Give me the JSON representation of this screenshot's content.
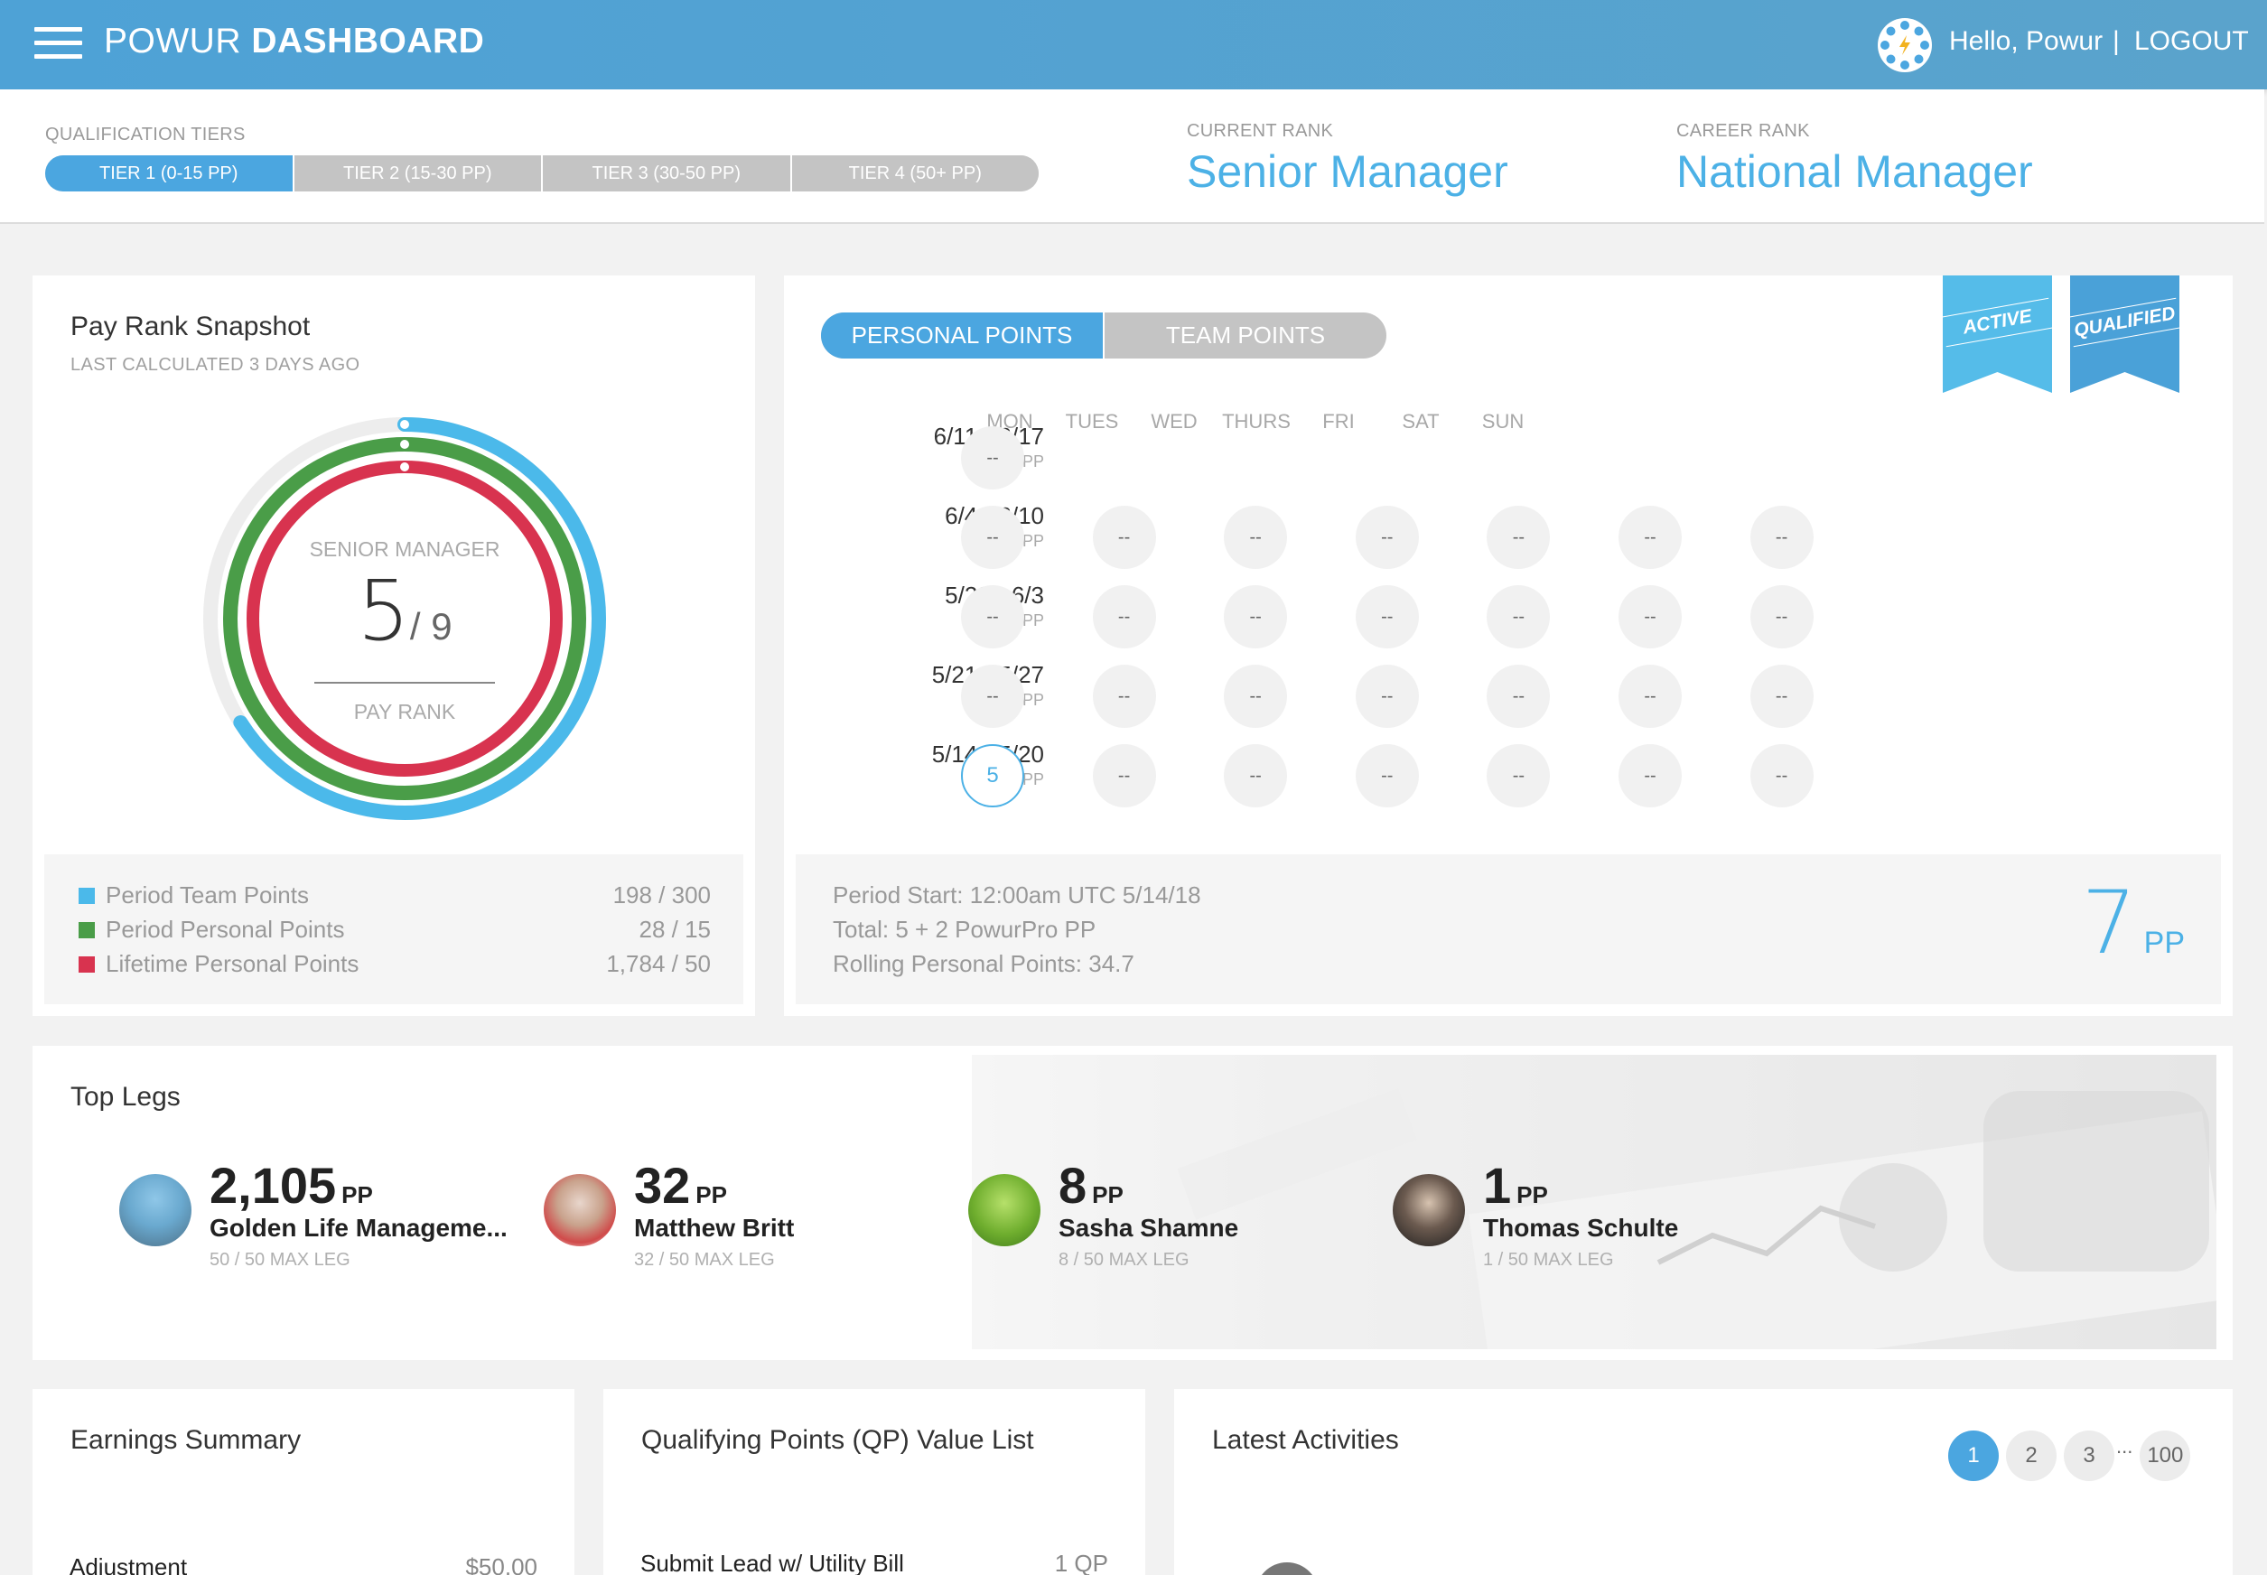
{
  "header": {
    "brand_light": "POWUR ",
    "brand_bold": "DASHBOARD",
    "greeting": "Hello, Powur",
    "separator": "|",
    "logout": "LOGOUT"
  },
  "tiers": {
    "label": "QUALIFICATION TIERS",
    "items": [
      "TIER 1 (0-15 PP)",
      "TIER 2 (15-30 PP)",
      "TIER 3 (30-50 PP)",
      "TIER 4 (50+ PP)"
    ],
    "active_index": 0
  },
  "ranks": {
    "current_label": "CURRENT RANK",
    "current_value": "Senior Manager",
    "career_label": "CAREER RANK",
    "career_value": "National Manager"
  },
  "pay_rank": {
    "title": "Pay Rank Snapshot",
    "subtitle": "LAST CALCULATED 3 DAYS AGO",
    "rank_name": "SENIOR MANAGER",
    "rank_num": "5",
    "rank_of": "/ 9",
    "rank_caption": "PAY RANK",
    "rings": [
      {
        "name": "Period Team Points",
        "color": "#4bb9ea",
        "fraction": 0.66
      },
      {
        "name": "Period Personal Points",
        "color": "#4a9d48",
        "fraction": 1.0
      },
      {
        "name": "Lifetime Personal Points",
        "color": "#d8334f",
        "fraction": 1.0
      }
    ],
    "legend": [
      {
        "label": "Period Team Points",
        "value": "198 / 300",
        "color": "#4bb9ea"
      },
      {
        "label": "Period Personal Points",
        "value": "28 / 15",
        "color": "#4a9d48"
      },
      {
        "label": "Lifetime Personal Points",
        "value": "1,784 / 50",
        "color": "#d8334f"
      }
    ]
  },
  "points": {
    "toggle": [
      "PERSONAL POINTS",
      "TEAM POINTS"
    ],
    "badges": [
      "ACTIVE",
      "QUALIFIED"
    ],
    "badge_colors": [
      "#55bce9",
      "#4aa1d8"
    ],
    "days": [
      "MON",
      "TUES",
      "WED",
      "THURS",
      "FRI",
      "SAT",
      "SUN"
    ],
    "weeks": [
      {
        "range": "6/11 - 6/17",
        "pp": "0 PP",
        "cells": [
          "--"
        ]
      },
      {
        "range": "6/4 - 6/10",
        "pp": "0 PP",
        "cells": [
          "--",
          "--",
          "--",
          "--",
          "--",
          "--",
          "--"
        ]
      },
      {
        "range": "5/28 - 6/3",
        "pp": "0 PP",
        "cells": [
          "--",
          "--",
          "--",
          "--",
          "--",
          "--",
          "--"
        ]
      },
      {
        "range": "5/21 - 5/27",
        "pp": "0 PP",
        "cells": [
          "--",
          "--",
          "--",
          "--",
          "--",
          "--",
          "--"
        ]
      },
      {
        "range": "5/14 - 5/20",
        "pp": "5 PP",
        "cells": [
          "5",
          "--",
          "--",
          "--",
          "--",
          "--",
          "--"
        ]
      }
    ],
    "period_start": "Period Start: 12:00am UTC 5/14/18",
    "total": "Total: 5 + 2 PowurPro PP",
    "rolling": "Rolling Personal Points: 34.7",
    "big_value": "7",
    "big_unit": "PP"
  },
  "top_legs": {
    "title": "Top Legs",
    "legs": [
      {
        "points": "2,105",
        "unit": "PP",
        "name": "Golden Life Manageme...",
        "max": "50 / 50 MAX LEG",
        "avatar": "group-photo"
      },
      {
        "points": "32",
        "unit": "PP",
        "name": "Matthew Britt",
        "max": "32 / 50 MAX LEG",
        "avatar": "person-photo"
      },
      {
        "points": "8",
        "unit": "PP",
        "name": "Sasha Shamne",
        "max": "8 / 50 MAX LEG",
        "avatar": "grass-photo"
      },
      {
        "points": "1",
        "unit": "PP",
        "name": "Thomas Schulte",
        "max": "1 / 50 MAX LEG",
        "avatar": "person-photo"
      }
    ]
  },
  "earnings": {
    "title": "Earnings Summary",
    "rows": [
      {
        "label": "Adjustment",
        "value": "$50.00"
      }
    ]
  },
  "qp_list": {
    "title": "Qualifying Points (QP) Value List",
    "rows": [
      {
        "label": "Submit Lead w/ Utility Bill",
        "value": "1 QP"
      }
    ]
  },
  "activities": {
    "title": "Latest Activities",
    "pages": [
      "1",
      "2",
      "3",
      "100"
    ],
    "ellipsis": "...",
    "active_page": "1"
  }
}
